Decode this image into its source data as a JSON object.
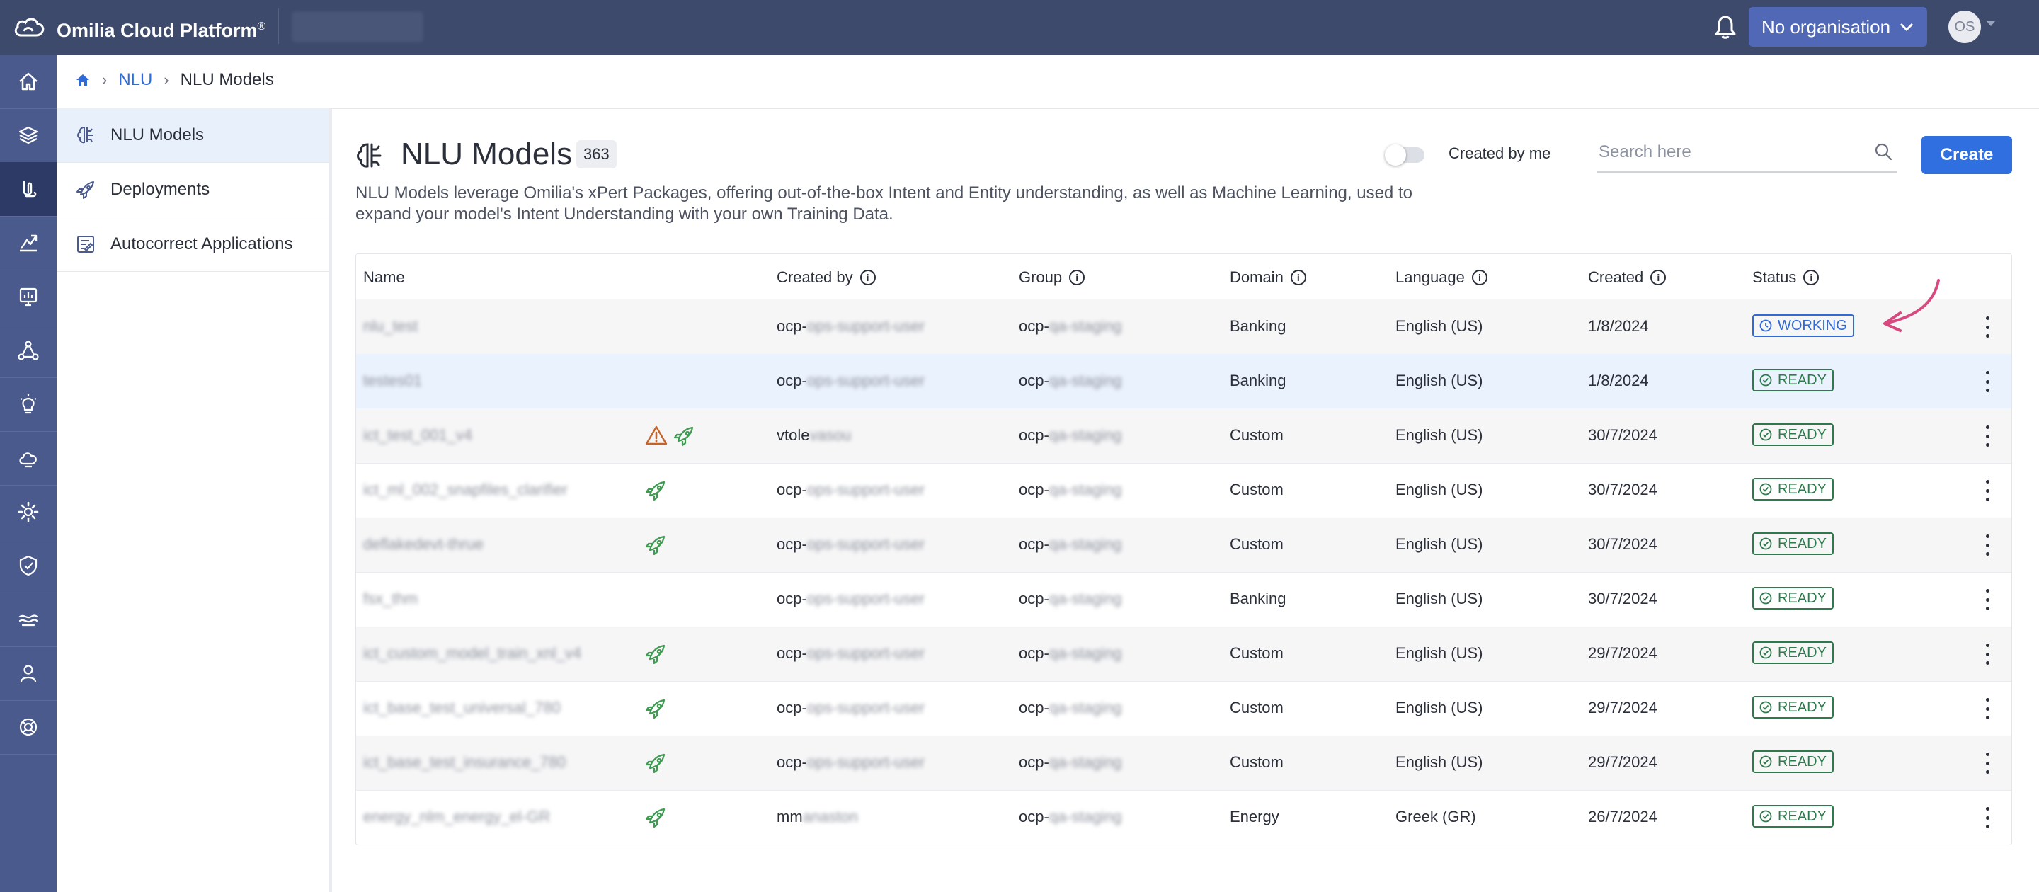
{
  "topbar": {
    "brand_name": "Omilia Cloud Platform",
    "brand_mark": "®",
    "org_button": "No organisation",
    "avatar_initials": "OS"
  },
  "rail": {
    "icons": [
      "home-icon",
      "layers-icon",
      "nlu-icon",
      "analytics-icon",
      "reports-icon",
      "network-icon",
      "ideas-icon",
      "cloud-icon",
      "settings-icon",
      "shield-icon",
      "speech-icon",
      "user-icon",
      "support-icon"
    ],
    "active_index": 2
  },
  "breadcrumb": {
    "items": [
      "NLU",
      "NLU Models"
    ]
  },
  "side_nav": {
    "items": [
      {
        "label": "NLU Models",
        "icon": "brain-icon",
        "active": true
      },
      {
        "label": "Deployments",
        "icon": "rocket-icon",
        "active": false
      },
      {
        "label": "Autocorrect Applications",
        "icon": "autocorrect-icon",
        "active": false
      }
    ]
  },
  "page": {
    "title": "NLU Models",
    "count": "363",
    "toggle_label": "Created by me",
    "search_placeholder": "Search here",
    "create_label": "Create",
    "description": "NLU Models leverage Omilia's xPert Packages, offering out-of-the-box Intent and Entity understanding, as well as Machine Learning, used to expand your model's Intent Understanding with your own Training Data."
  },
  "table": {
    "columns": [
      "Name",
      "Created by",
      "Group",
      "Domain",
      "Language",
      "Created",
      "Status"
    ],
    "rows": [
      {
        "name": "nlu_test",
        "warn": false,
        "rocket": false,
        "created_by_prefix": "ocp-",
        "created_by_rest": "ops-support-user",
        "group_prefix": "ocp-",
        "group_rest": "qa-staging",
        "domain": "Banking",
        "language": "English (US)",
        "created": "1/8/2024",
        "status": "WORKING"
      },
      {
        "name": "testes01",
        "warn": false,
        "rocket": false,
        "created_by_prefix": "ocp-",
        "created_by_rest": "ops-support-user",
        "group_prefix": "ocp-",
        "group_rest": "qa-staging",
        "domain": "Banking",
        "language": "English (US)",
        "created": "1/8/2024",
        "status": "READY"
      },
      {
        "name": "ict_test_001_v4",
        "warn": true,
        "rocket": true,
        "created_by_prefix": "vtole",
        "created_by_rest": "vasou",
        "group_prefix": "ocp-",
        "group_rest": "qa-staging",
        "domain": "Custom",
        "language": "English (US)",
        "created": "30/7/2024",
        "status": "READY"
      },
      {
        "name": "ict_ml_002_snapfiles_clarifier",
        "warn": false,
        "rocket": true,
        "created_by_prefix": "ocp-",
        "created_by_rest": "ops-support-user",
        "group_prefix": "ocp-",
        "group_rest": "qa-staging",
        "domain": "Custom",
        "language": "English (US)",
        "created": "30/7/2024",
        "status": "READY"
      },
      {
        "name": "deflakedevt-thrue",
        "warn": false,
        "rocket": true,
        "created_by_prefix": "ocp-",
        "created_by_rest": "ops-support-user",
        "group_prefix": "ocp-",
        "group_rest": "qa-staging",
        "domain": "Custom",
        "language": "English (US)",
        "created": "30/7/2024",
        "status": "READY"
      },
      {
        "name": "fsx_thm",
        "warn": false,
        "rocket": false,
        "created_by_prefix": "ocp-",
        "created_by_rest": "ops-support-user",
        "group_prefix": "ocp-",
        "group_rest": "qa-staging",
        "domain": "Banking",
        "language": "English (US)",
        "created": "30/7/2024",
        "status": "READY"
      },
      {
        "name": "ict_custom_model_train_xnl_v4",
        "warn": false,
        "rocket": true,
        "created_by_prefix": "ocp-",
        "created_by_rest": "ops-support-user",
        "group_prefix": "ocp-",
        "group_rest": "qa-staging",
        "domain": "Custom",
        "language": "English (US)",
        "created": "29/7/2024",
        "status": "READY"
      },
      {
        "name": "ict_base_test_universal_780",
        "warn": false,
        "rocket": true,
        "created_by_prefix": "ocp-",
        "created_by_rest": "ops-support-user",
        "group_prefix": "ocp-",
        "group_rest": "qa-staging",
        "domain": "Custom",
        "language": "English (US)",
        "created": "29/7/2024",
        "status": "READY"
      },
      {
        "name": "ict_base_test_insurance_780",
        "warn": false,
        "rocket": true,
        "created_by_prefix": "ocp-",
        "created_by_rest": "ops-support-user",
        "group_prefix": "ocp-",
        "group_rest": "qa-staging",
        "domain": "Custom",
        "language": "English (US)",
        "created": "29/7/2024",
        "status": "READY"
      },
      {
        "name": "energy_nlm_energy_el-GR",
        "warn": false,
        "rocket": true,
        "created_by_prefix": "mm",
        "created_by_rest": "anaston",
        "group_prefix": "ocp-",
        "group_rest": "qa-staging",
        "domain": "Energy",
        "language": "Greek (GR)",
        "created": "26/7/2024",
        "status": "READY"
      }
    ]
  },
  "colors": {
    "topbar": "#3d4a6c",
    "rail": "#4a5a8c",
    "accent": "#2f6fe0",
    "ready": "#2e7a4c",
    "working": "#2f6bd8",
    "annotation_arrow": "#d64a7f"
  }
}
